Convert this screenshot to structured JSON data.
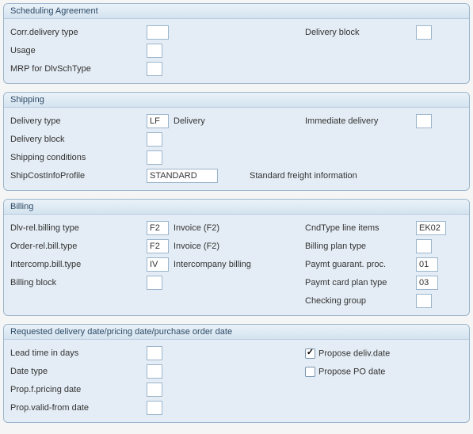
{
  "sched": {
    "title": "Scheduling Agreement",
    "corr_del_type_label": "Corr.delivery type",
    "corr_del_type_value": "",
    "delivery_block_label": "Delivery block",
    "delivery_block_value": "",
    "usage_label": "Usage",
    "usage_value": "",
    "mrp_label": "MRP for DlvSchType",
    "mrp_value": ""
  },
  "shipping": {
    "title": "Shipping",
    "delivery_type_label": "Delivery type",
    "delivery_type_value": "LF",
    "delivery_type_desc": "Delivery",
    "immediate_delivery_label": "Immediate delivery",
    "immediate_delivery_value": "",
    "delivery_block_label": "Delivery block",
    "delivery_block_value": "",
    "shipping_cond_label": "Shipping conditions",
    "shipping_cond_value": "",
    "shipcost_label": "ShipCostInfoProfile",
    "shipcost_value": "STANDARD",
    "shipcost_desc": "Standard freight information"
  },
  "billing": {
    "title": "Billing",
    "dlv_rel_label": "Dlv-rel.billing type",
    "dlv_rel_value": "F2",
    "dlv_rel_desc": "Invoice (F2)",
    "cndtype_label": "CndType line items",
    "cndtype_value": "EK02",
    "order_rel_label": "Order-rel.bill.type",
    "order_rel_value": "F2",
    "order_rel_desc": "Invoice (F2)",
    "bill_plan_type_label": "Billing plan type",
    "bill_plan_type_value": "",
    "intercomp_label": "Intercomp.bill.type",
    "intercomp_value": "IV",
    "intercomp_desc": "Intercompany billing",
    "paymt_guar_label": "Paymt guarant. proc.",
    "paymt_guar_value": "01",
    "bill_block_label": "Billing block",
    "bill_block_value": "",
    "paymt_card_label": "Paymt card plan type",
    "paymt_card_value": "03",
    "checking_group_label": "Checking group",
    "checking_group_value": ""
  },
  "requested": {
    "title": "Requested delivery date/pricing date/purchase order date",
    "lead_time_label": "Lead time in days",
    "lead_time_value": "",
    "propose_deliv_label": "Propose deliv.date",
    "propose_deliv_checked": true,
    "date_type_label": "Date type",
    "date_type_value": "",
    "propose_po_label": "Propose PO date",
    "propose_po_checked": false,
    "prop_pricing_label": "Prop.f.pricing date",
    "prop_pricing_value": "",
    "prop_valid_label": "Prop.valid-from date",
    "prop_valid_value": ""
  }
}
